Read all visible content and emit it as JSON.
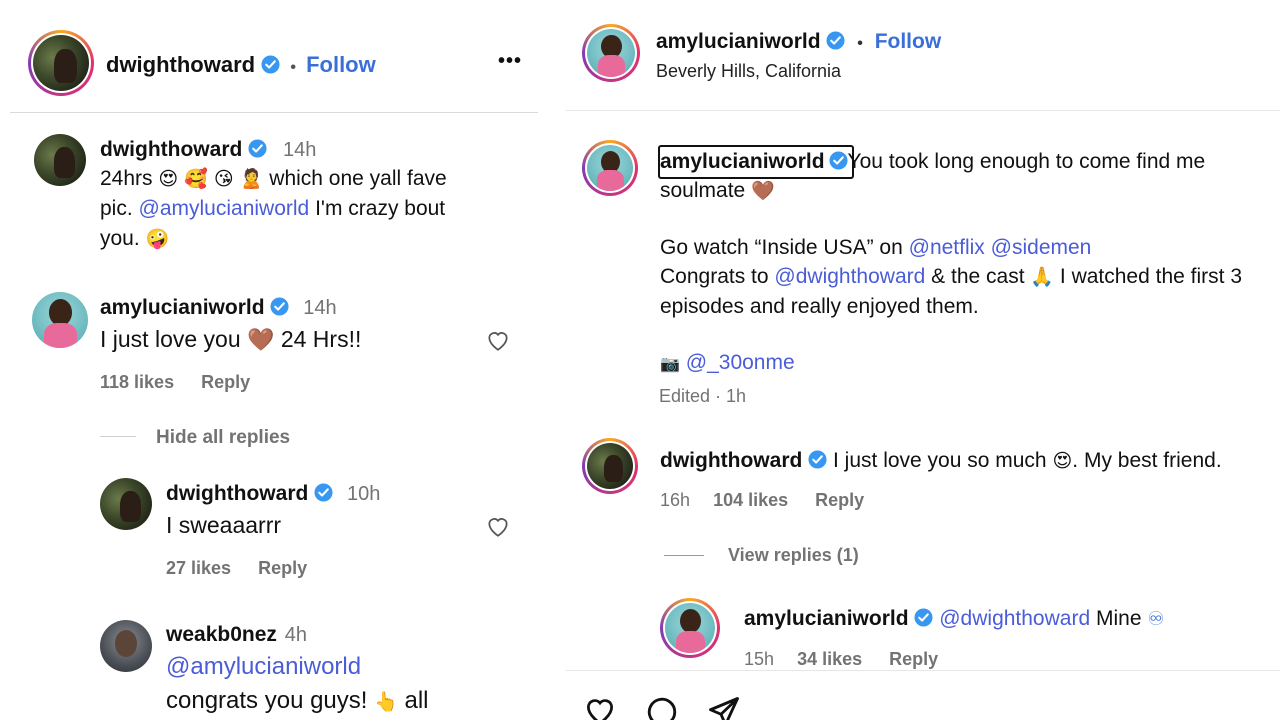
{
  "left": {
    "header": {
      "username": "dwighthoward",
      "separator": "•",
      "follow": "Follow",
      "more": "•••"
    },
    "caption": {
      "username": "dwighthoward",
      "time": "14h",
      "line1_pre": "24hrs",
      "line1_emojis": "😍 🥰 😘 🙎",
      "line1_post": "which one yall fave",
      "line2_pre": "pic.",
      "line2_mention": "@amylucianiworld",
      "line2_post": "I'm crazy bout",
      "line3": "you.",
      "line3_emoji": "🤪"
    },
    "comments": [
      {
        "username": "amylucianiworld",
        "time": "14h",
        "text_pre": "I just love you",
        "emoji": "🤎",
        "text_post": "24 Hrs!!",
        "likes": "118 likes",
        "reply": "Reply"
      }
    ],
    "hide_replies": "Hide all replies",
    "replies": [
      {
        "username": "dwighthoward",
        "time": "10h",
        "text": "I sweaaarrr",
        "likes": "27 likes",
        "reply": "Reply"
      },
      {
        "username": "weakb0nez",
        "time": "4h",
        "mention": "@amylucianiworld",
        "text_pre": "congrats you guys!",
        "emoji": "👆",
        "text_post": "all"
      }
    ]
  },
  "right": {
    "header": {
      "username": "amylucianiworld",
      "separator": "•",
      "follow": "Follow",
      "location": "Beverly Hills, California"
    },
    "caption": {
      "username": "amylucianiworld",
      "line1": "You took long enough to come find me",
      "line2": "soulmate",
      "line2_emoji": "🤎",
      "line3_pre": "Go watch “Inside USA” on",
      "line3_mention1": "@netflix",
      "line3_mention2": "@sidemen",
      "line4_pre": "Congrats to",
      "line4_mention": "@dwighthoward",
      "line4_post": "& the cast",
      "line4_emoji": "🙏",
      "line4_post2": "I watched the first 3",
      "line5": "episodes and really enjoyed them.",
      "camera_emoji": "📷",
      "credit_mention": "@_30onme",
      "edited": "Edited · 1h"
    },
    "comment": {
      "username": "dwighthoward",
      "text_pre": "I just love you so much",
      "emoji": "😍",
      "text_post": ". My best friend.",
      "time": "16h",
      "likes": "104 likes",
      "reply": "Reply",
      "view_replies": "View replies (1)"
    },
    "reply": {
      "username": "amylucianiworld",
      "mention": "@dwighthoward",
      "text": "Mine",
      "emoji": "♾",
      "time": "15h",
      "likes": "34 likes",
      "reply": "Reply"
    }
  },
  "colors": {
    "mention": "#4a5cd8",
    "follow": "#3b6fd8",
    "verified": "#3897f0",
    "muted": "#737373"
  }
}
